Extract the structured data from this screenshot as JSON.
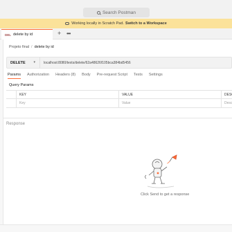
{
  "search": {
    "label": "Search Postman"
  },
  "banner": {
    "text": "Working locally in Scratch Pad.",
    "link": "Switch to a Workspace"
  },
  "tab": {
    "method": "DEL",
    "title": "delete by id"
  },
  "breadcrumb": {
    "parent": "Projeto final",
    "separator": "/",
    "current": "delete by id"
  },
  "request": {
    "method": "DELETE",
    "url": "localhost:8080/texts/delete/62a48626f105bca384bd5456"
  },
  "request_tabs": [
    {
      "label": "Params"
    },
    {
      "label": "Authorization"
    },
    {
      "label": "Headers (8)"
    },
    {
      "label": "Body"
    },
    {
      "label": "Pre-request Script"
    },
    {
      "label": "Tests"
    },
    {
      "label": "Settings"
    }
  ],
  "query_params": {
    "title": "Query Params",
    "headers": {
      "key": "KEY",
      "value": "VALUE",
      "desc": "DESCI"
    },
    "row": {
      "key": "Key",
      "value": "Value",
      "desc": "Descr"
    }
  },
  "response": {
    "title": "Response",
    "empty_text": "Click Send to get a response"
  }
}
